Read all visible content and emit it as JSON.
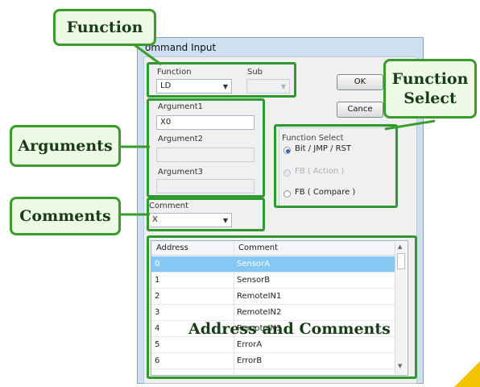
{
  "dialog": {
    "title": "ommand Input",
    "function_label": "Function",
    "function_value": "LD",
    "sub_label": "Sub",
    "ok_label": "OK",
    "cancel_label": "Cance",
    "argument1_label": "Argument1",
    "argument1_value": "X0",
    "argument2_label": "Argument2",
    "argument3_label": "Argument3",
    "function_select_label": "Function Select",
    "function_select_options": [
      "Bit / JMP / RST",
      "FB ( Action )",
      "FB ( Compare )"
    ],
    "function_select_selected": "Bit / JMP / RST",
    "comment_label": "Comment",
    "comment_value": "X",
    "table": {
      "headers": [
        "Address",
        "Comment"
      ],
      "rows": [
        {
          "address": "0",
          "comment": "SensorA"
        },
        {
          "address": "1",
          "comment": "SensorB"
        },
        {
          "address": "2",
          "comment": "RemoteIN1"
        },
        {
          "address": "3",
          "comment": "RemoteIN2"
        },
        {
          "address": "4",
          "comment": "RemoteIN3"
        },
        {
          "address": "5",
          "comment": "ErrorA"
        },
        {
          "address": "6",
          "comment": "ErrorB"
        }
      ],
      "selected_index": 0
    }
  },
  "callouts": {
    "function": "Function",
    "function_select": "Function Select",
    "arguments": "Arguments",
    "comments": "Comments",
    "address_and_comments": "Address and Comments"
  },
  "colors": {
    "callout_border": "#3a9d2b",
    "callout_fill": "#eef9e6",
    "selection": "#86c7f4",
    "corner_accent": "#f5c400"
  }
}
